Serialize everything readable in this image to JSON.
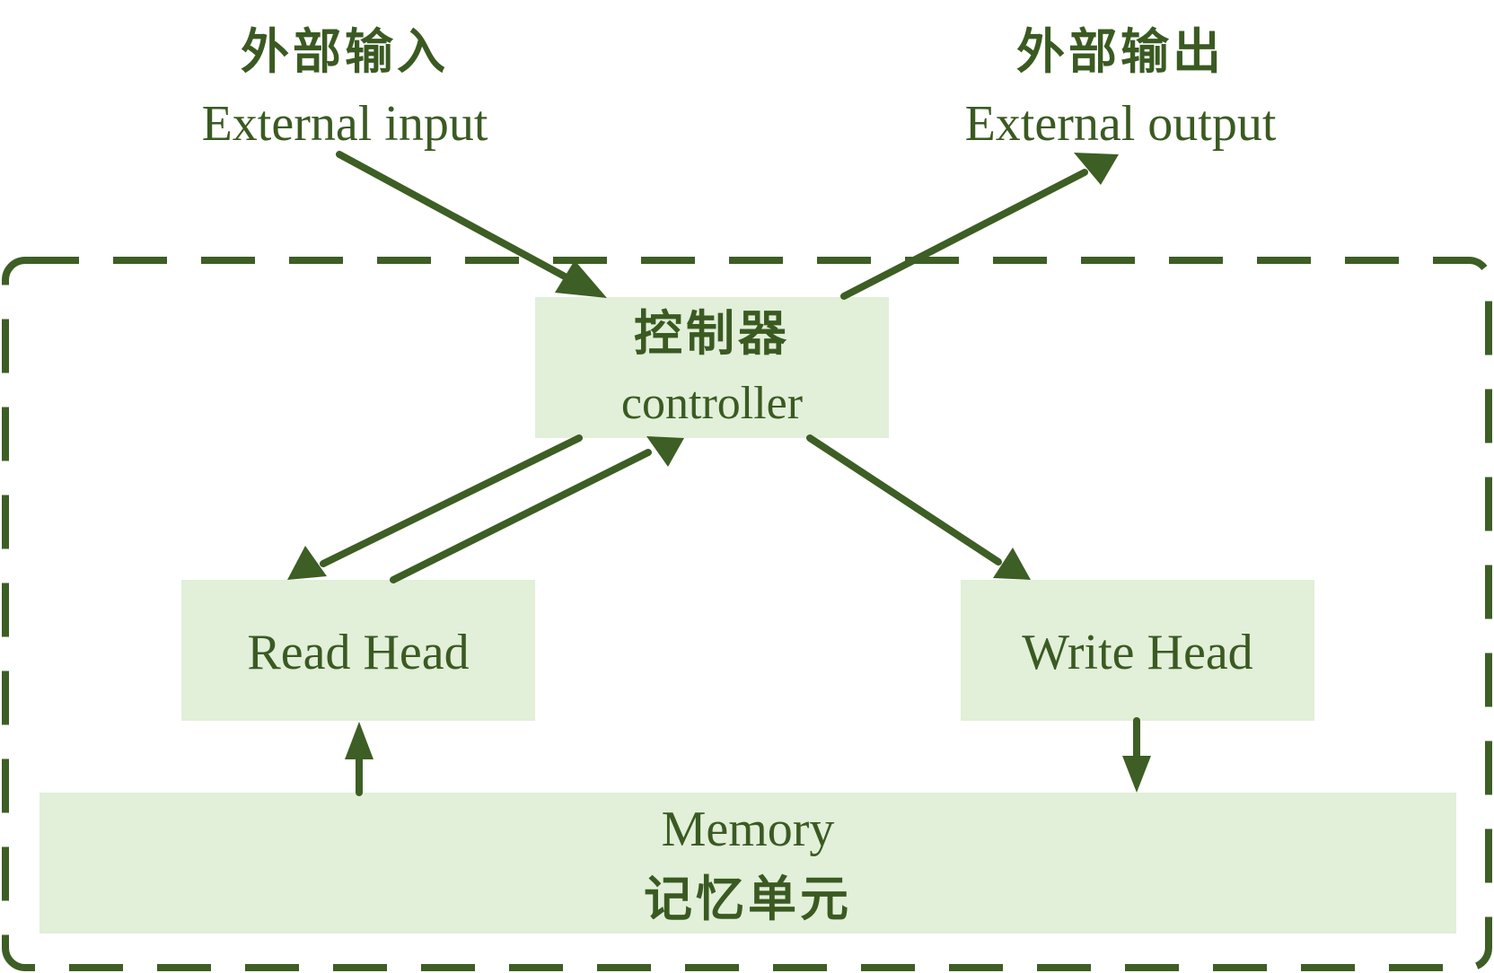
{
  "colors": {
    "stroke": "#3d5e24",
    "box_fill": "#e2efd9",
    "text": "#3a5a22",
    "background": "#ffffff"
  },
  "external_input": {
    "label_cn": "外部输入",
    "label_en": "External input"
  },
  "external_output": {
    "label_cn": "外部输出",
    "label_en": "External output"
  },
  "controller": {
    "label_cn": "控制器",
    "label_en": "controller"
  },
  "read_head": {
    "label": "Read Head"
  },
  "write_head": {
    "label": "Write Head"
  },
  "memory": {
    "label_en": "Memory",
    "label_cn": "记忆单元"
  }
}
